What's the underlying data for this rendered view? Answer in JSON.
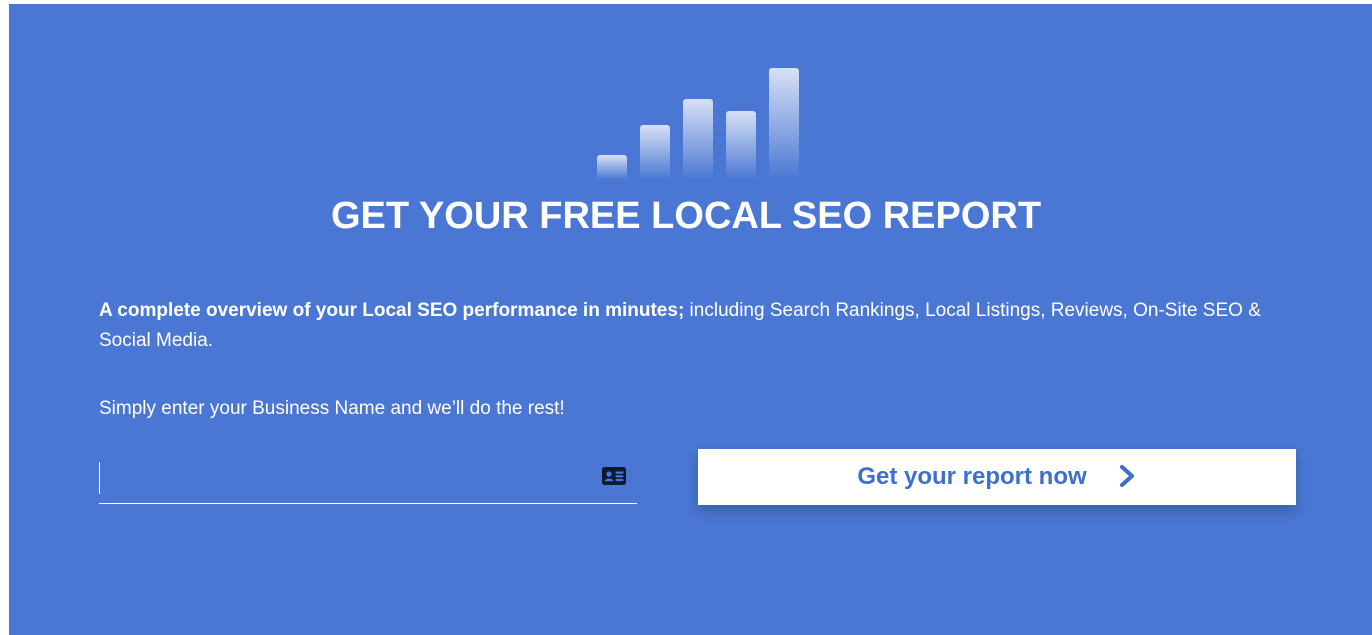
{
  "hero": {
    "title": "GET YOUR FREE LOCAL SEO REPORT",
    "description_bold": "A complete overview of your Local SEO performance in minutes;",
    "description_rest": " including Search Rankings, Local Listings, Reviews, On-Site SEO & Social Media.",
    "prompt": "Simply enter your Business Name and we’ll do the rest!"
  },
  "form": {
    "business_input_value": "",
    "business_input_placeholder": "",
    "input_icon": "contact-card-icon",
    "submit_label": "Get your report now",
    "submit_icon": "chevron-right-icon"
  },
  "decoration": {
    "chart_icon": "bar-chart-icon",
    "bar_levels": [
      0.15,
      0.42,
      0.68,
      0.55,
      1.0
    ]
  },
  "colors": {
    "background": "#4a77d3",
    "text": "#ffffff",
    "button_bg": "#ffffff",
    "button_text": "#3f6fce"
  }
}
